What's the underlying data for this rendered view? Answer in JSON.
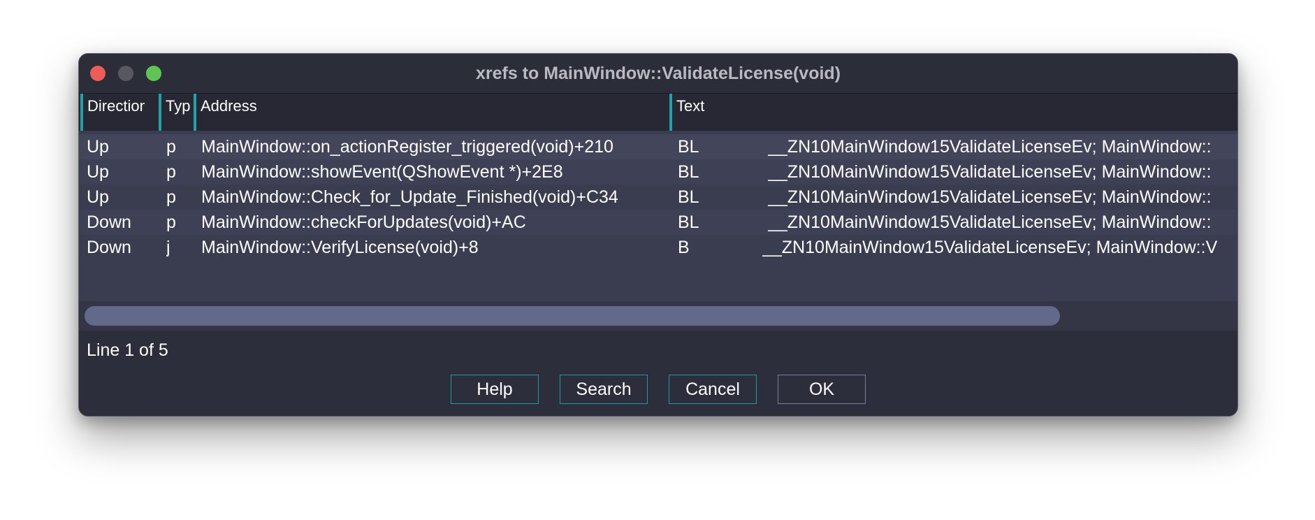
{
  "window": {
    "title": "xrefs to MainWindow::ValidateLicense(void)"
  },
  "table": {
    "columns": [
      "Direction",
      "Typ",
      "Address",
      "Text"
    ],
    "rows": [
      {
        "direction": "Up",
        "type": "p",
        "address": "MainWindow::on_actionRegister_triggered(void)+210",
        "mnemonic": "BL",
        "text": "__ZN10MainWindow15ValidateLicenseEv; MainWindow::"
      },
      {
        "direction": "Up",
        "type": "p",
        "address": "MainWindow::showEvent(QShowEvent *)+2E8",
        "mnemonic": "BL",
        "text": "__ZN10MainWindow15ValidateLicenseEv; MainWindow::"
      },
      {
        "direction": "Up",
        "type": "p",
        "address": "MainWindow::Check_for_Update_Finished(void)+C34",
        "mnemonic": "BL",
        "text": "__ZN10MainWindow15ValidateLicenseEv; MainWindow::"
      },
      {
        "direction": "Down",
        "type": "p",
        "address": "MainWindow::checkForUpdates(void)+AC",
        "mnemonic": "BL",
        "text": "__ZN10MainWindow15ValidateLicenseEv; MainWindow::"
      },
      {
        "direction": "Down",
        "type": "j",
        "address": "MainWindow::VerifyLicense(void)+8",
        "mnemonic": "B",
        "text": "__ZN10MainWindow15ValidateLicenseEv; MainWindow::V"
      }
    ]
  },
  "status": {
    "line": "Line 1 of 5"
  },
  "buttons": {
    "help": "Help",
    "search": "Search",
    "cancel": "Cancel",
    "ok": "OK"
  },
  "colors": {
    "accent": "#1fa3a8",
    "close": "#ee5d55",
    "zoom": "#5fc454"
  }
}
